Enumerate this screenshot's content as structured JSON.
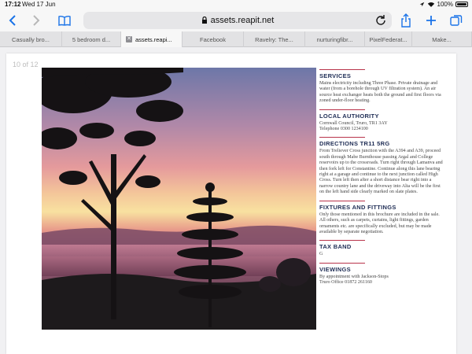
{
  "status": {
    "time": "17:12",
    "date": "Wed 17 Jun",
    "battery": "100%"
  },
  "toolbar": {
    "url": "assets.reapit.net"
  },
  "tabs": [
    {
      "label": "Casually bro...",
      "active": false
    },
    {
      "label": "5 bedroom d...",
      "active": false
    },
    {
      "label": "assets.reapi...",
      "active": true
    },
    {
      "label": "Facebook",
      "active": false
    },
    {
      "label": "Ravelry: The...",
      "active": false
    },
    {
      "label": "nurturingfibr...",
      "active": false
    },
    {
      "label": "PixelFederat...",
      "active": false
    },
    {
      "label": "Make...",
      "active": false
    }
  ],
  "document": {
    "page_indicator": "10 of 12",
    "sections": [
      {
        "title": "SERVICES",
        "body": "Mains electricity including Three Phase. Private drainage and water (from a borehole through UV filtration system). An air source heat exchanger heats both the ground and first floors via zoned under-floor heating."
      },
      {
        "title": "LOCAL AUTHORITY",
        "body": "Cornwall Council, Truro, TR1 3AY\nTelephone 0300 1234100"
      },
      {
        "title": "DIRECTIONS TR11 5RG",
        "body": "From Treliever Cross junction with the A394 and A39, proceed south through Mabe Burnthouse passing Argal and College reservoirs up to the crossroads. Turn right through Lamanva and then fork left for Constantine. Continue along this lane bearing right at a garage and continue to the next junction called High Cross. Turn left then after a short distance bear right into a narrow country lane and the driveway into Alta will be the first on the left hand side clearly marked on slate plates."
      },
      {
        "title": "FIXTURES AND FITTINGS",
        "body": "Only those mentioned in this brochure are included in the sale. All others, such as carpets, curtains, light fittings, garden ornaments etc. are specifically excluded, but may be made available by separate negotiation."
      },
      {
        "title": "TAX BAND",
        "body": "G"
      },
      {
        "title": "VIEWINGS",
        "body": "By appointment with Jackson-Stops\nTruro Office 01872 261160"
      }
    ]
  },
  "colors": {
    "accent_link": "#1a73e8",
    "heading": "#1f2d55",
    "rule": "#b9344b"
  },
  "icons": [
    "back-icon",
    "forward-icon",
    "bookmarks-icon",
    "lock-icon",
    "reload-icon",
    "share-icon",
    "new-tab-icon",
    "tabs-overview-icon",
    "wifi-icon",
    "battery-icon"
  ]
}
